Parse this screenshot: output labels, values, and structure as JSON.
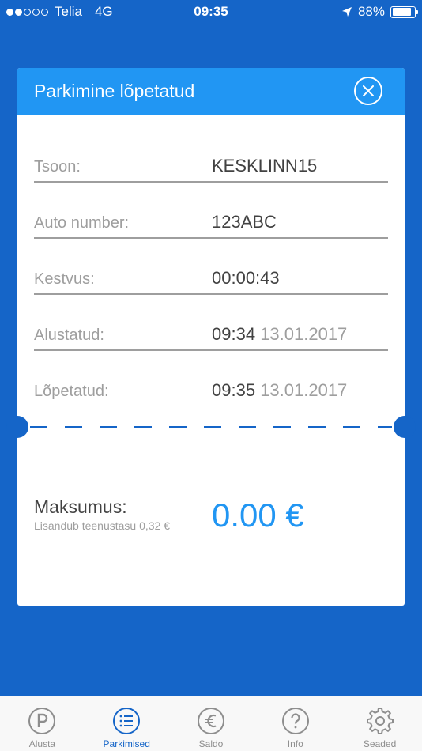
{
  "status_bar": {
    "carrier": "Telia",
    "network": "4G",
    "time": "09:35",
    "battery": "88%",
    "battery_level": 0.88
  },
  "card": {
    "title": "Parkimine lõpetatud",
    "close_icon": "close-circle-icon",
    "rows": [
      {
        "label": "Tsoon:",
        "value": "KESKLINN15"
      },
      {
        "label": "Auto number:",
        "value": "123ABC"
      },
      {
        "label": "Kestvus:",
        "value": "00:00:43"
      },
      {
        "label": "Alustatud:",
        "time": "09:34",
        "date": "13.01.2017"
      },
      {
        "label": "Lõpetatud:",
        "time": "09:35",
        "date": "13.01.2017"
      }
    ],
    "total_label": "Maksumus:",
    "total_note": "Lisandub teenustasu 0,32 €",
    "total_value": "0.00 €"
  },
  "tabs": [
    {
      "label": "Alusta",
      "icon": "parking-icon",
      "active": false
    },
    {
      "label": "Parkimised",
      "icon": "list-icon",
      "active": true
    },
    {
      "label": "Saldo",
      "icon": "euro-icon",
      "active": false
    },
    {
      "label": "Info",
      "icon": "question-icon",
      "active": false
    },
    {
      "label": "Seaded",
      "icon": "gear-icon",
      "active": false
    }
  ],
  "colors": {
    "background": "#1565c8",
    "header": "#2196f3",
    "accent": "#2196f3",
    "tab_active": "#1565c8",
    "tab_inactive": "#8e8e8e"
  }
}
